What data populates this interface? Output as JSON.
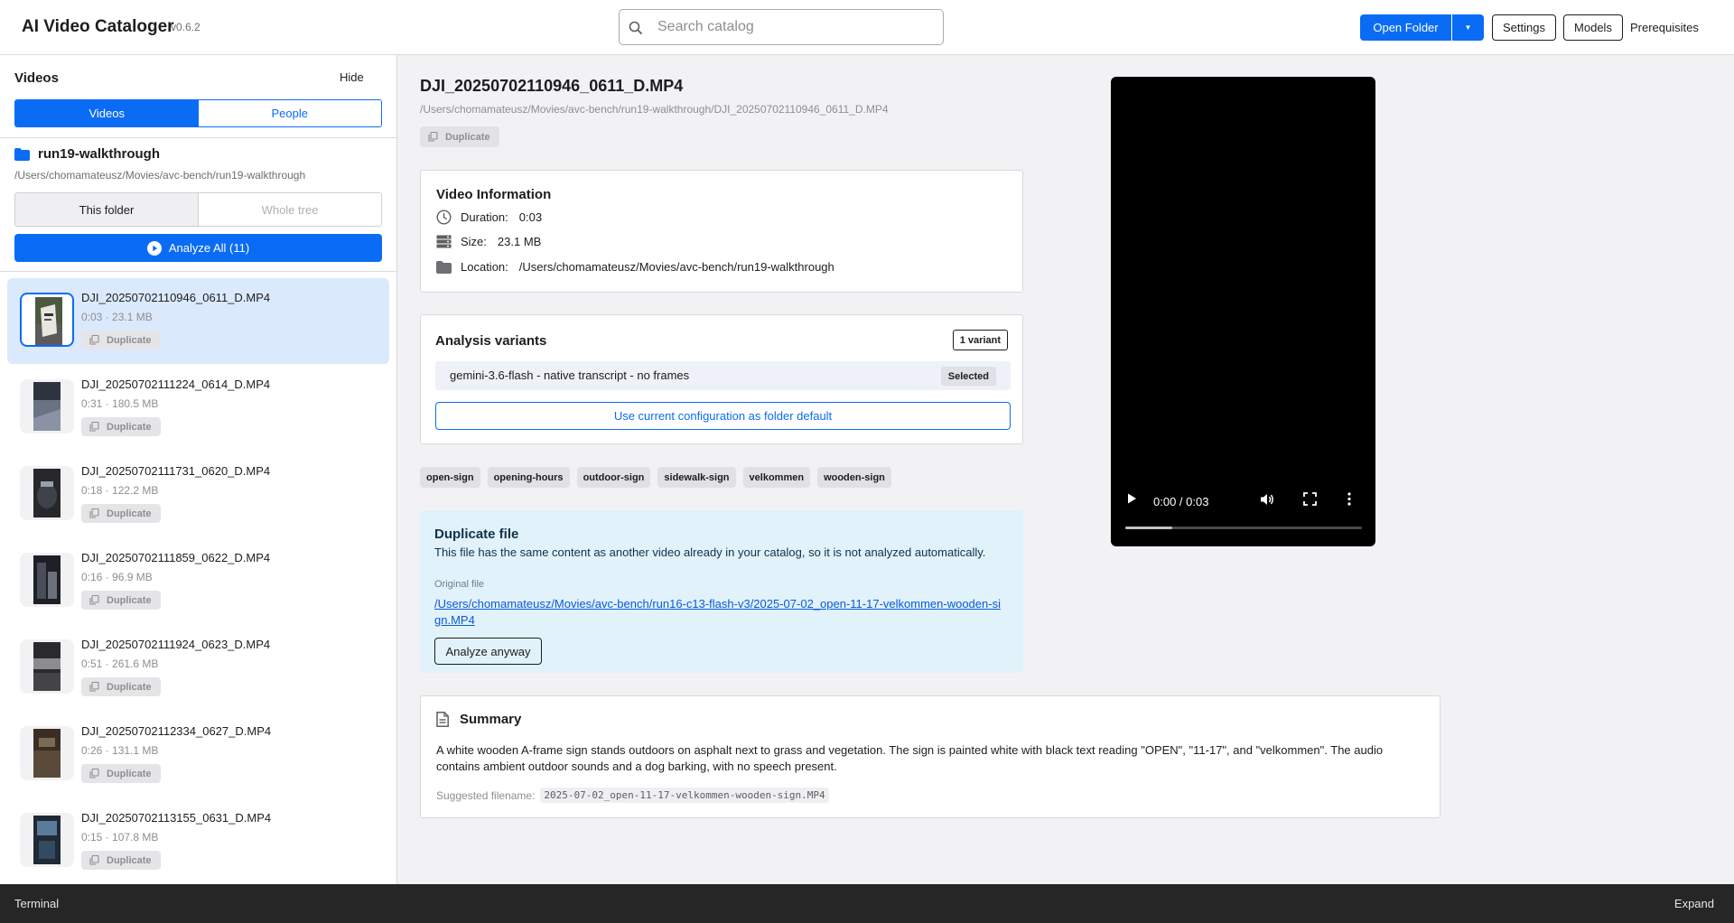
{
  "header": {
    "title": "AI Video Cataloger",
    "version": "v0.6.2",
    "search_placeholder": "Search catalog",
    "open_folder": "Open Folder",
    "settings": "Settings",
    "models": "Models",
    "prerequisites": "Prerequisites"
  },
  "sidebar": {
    "title": "Videos",
    "hide": "Hide",
    "tabs": [
      "Videos",
      "People"
    ],
    "folder_name": "run19-walkthrough",
    "folder_path": "/Users/chomamateusz/Movies/avc-bench/run19-walkthrough",
    "scope": [
      "This folder",
      "Whole tree"
    ],
    "analyze_all": "Analyze All (11)",
    "videos": [
      {
        "name": "DJI_20250702110946_0611_D.MP4",
        "meta": "0:03 · 23.1 MB",
        "badge": "Duplicate"
      },
      {
        "name": "DJI_20250702111224_0614_D.MP4",
        "meta": "0:31 · 180.5 MB",
        "badge": "Duplicate"
      },
      {
        "name": "DJI_20250702111731_0620_D.MP4",
        "meta": "0:18 · 122.2 MB",
        "badge": "Duplicate"
      },
      {
        "name": "DJI_20250702111859_0622_D.MP4",
        "meta": "0:16 · 96.9 MB",
        "badge": "Duplicate"
      },
      {
        "name": "DJI_20250702111924_0623_D.MP4",
        "meta": "0:51 · 261.6 MB",
        "badge": "Duplicate"
      },
      {
        "name": "DJI_20250702112334_0627_D.MP4",
        "meta": "0:26 · 131.1 MB",
        "badge": "Duplicate"
      },
      {
        "name": "DJI_20250702113155_0631_D.MP4",
        "meta": "0:15 · 107.8 MB",
        "badge": "Duplicate"
      }
    ]
  },
  "main": {
    "title": "DJI_20250702110946_0611_D.MP4",
    "path": "/Users/chomamateusz/Movies/avc-bench/run19-walkthrough/DJI_20250702110946_0611_D.MP4",
    "duplicate_badge": "Duplicate",
    "info": {
      "title": "Video Information",
      "duration_label": "Duration:",
      "duration": "0:03",
      "size_label": "Size:",
      "size": "23.1 MB",
      "location_label": "Location:",
      "location": "/Users/chomamateusz/Movies/avc-bench/run19-walkthrough"
    },
    "variants": {
      "title": "Analysis variants",
      "count": "1 variant",
      "item": "gemini-3.6-flash - native transcript - no frames",
      "selected": "Selected",
      "default_button": "Use current configuration as folder default"
    },
    "tags": [
      "open-sign",
      "opening-hours",
      "outdoor-sign",
      "sidewalk-sign",
      "velkommen",
      "wooden-sign"
    ],
    "duplicate": {
      "title": "Duplicate file",
      "text": "This file has the same content as another video already in your catalog, so it is not analyzed automatically.",
      "original_label": "Original file",
      "original_path": "/Users/chomamateusz/Movies/avc-bench/run16-c13-flash-v3/2025-07-02_open-11-17-velkommen-wooden-sign.MP4",
      "analyze_button": "Analyze anyway"
    },
    "player": {
      "time": "0:00 / 0:03",
      "progress": 0.2
    },
    "summary": {
      "title": "Summary",
      "text": "A white wooden A-frame sign stands outdoors on asphalt next to grass and vegetation. The sign is painted white with black text reading \"OPEN\", \"11-17\", and \"velkommen\". The audio contains ambient outdoor sounds and a dog barking, with no speech present.",
      "filename_label": "Suggested filename:",
      "filename": "2025-07-02_open-11-17-velkommen-wooden-sign.MP4"
    }
  },
  "terminal": {
    "label": "Terminal",
    "expand": "Expand"
  },
  "colors": {
    "accent": "#0a6cf5",
    "selected_row": "#dbe9fd",
    "duplicate_card": "#e1f2fb",
    "terminal_bg": "#262626"
  }
}
